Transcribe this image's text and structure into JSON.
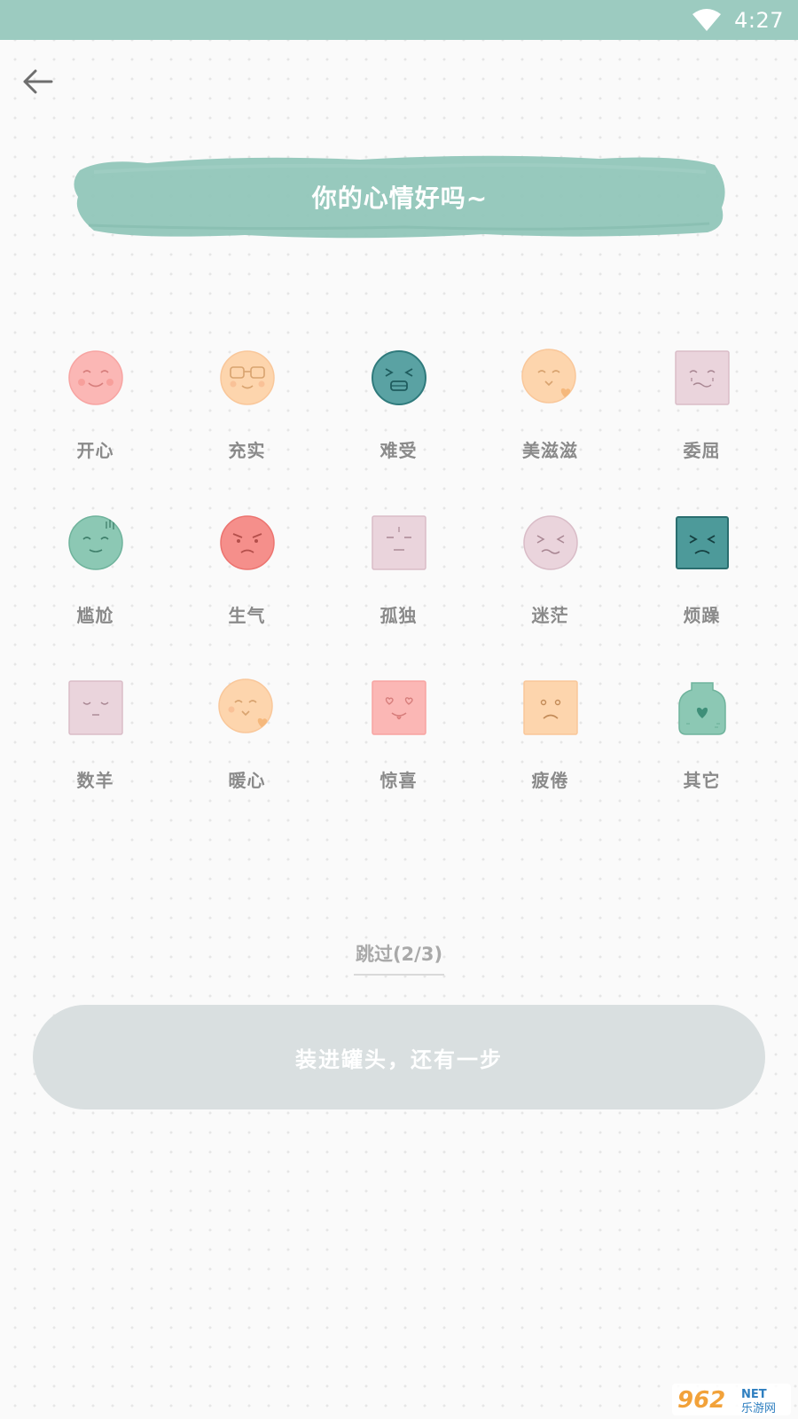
{
  "status_bar": {
    "time": "4:27",
    "wifi_icon": "wifi-icon",
    "background": "#9ccbc0"
  },
  "header": {
    "back_icon": "arrow-left-icon"
  },
  "title": {
    "text": "你的心情好吗~",
    "banner_color": "#8fc5b8"
  },
  "moods": [
    {
      "label": "开心",
      "icon": "happy-face-icon"
    },
    {
      "label": "充实",
      "icon": "glasses-face-icon"
    },
    {
      "label": "难受",
      "icon": "distressed-face-icon"
    },
    {
      "label": "美滋滋",
      "icon": "content-face-heart-icon"
    },
    {
      "label": "委屈",
      "icon": "aggrieved-square-icon"
    },
    {
      "label": "尴尬",
      "icon": "awkward-face-icon"
    },
    {
      "label": "生气",
      "icon": "angry-face-icon"
    },
    {
      "label": "孤独",
      "icon": "lonely-square-icon"
    },
    {
      "label": "迷茫",
      "icon": "confused-face-icon"
    },
    {
      "label": "烦躁",
      "icon": "irritated-square-icon"
    },
    {
      "label": "数羊",
      "icon": "sleepy-square-icon"
    },
    {
      "label": "暖心",
      "icon": "warm-face-heart-icon"
    },
    {
      "label": "惊喜",
      "icon": "heart-eyes-square-icon"
    },
    {
      "label": "疲倦",
      "icon": "tired-square-icon"
    },
    {
      "label": "其它",
      "icon": "jar-heart-icon"
    }
  ],
  "skip": {
    "label": "跳过(2/3)"
  },
  "submit": {
    "label": "装进罐头，还有一步",
    "background": "#d9dfe0"
  },
  "watermark": {
    "text": "962",
    "suffix": "NET",
    "subtitle": "乐游网"
  }
}
